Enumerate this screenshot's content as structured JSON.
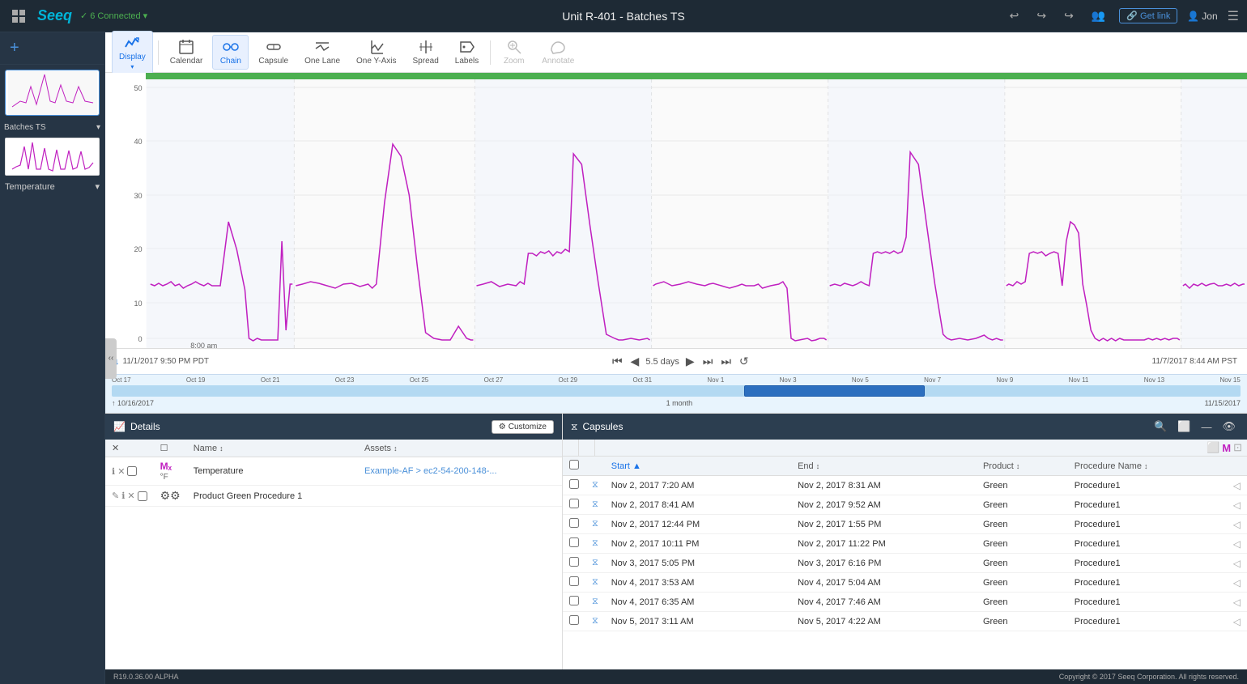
{
  "app": {
    "title": "Unit R-401 - Batches TS",
    "version": "R19.0.36.00 ALPHA",
    "copyright": "Copyright © 2017 Seeq Corporation. All rights reserved.",
    "logo": "Seeq",
    "connection": "6 Connected",
    "user": "Jon"
  },
  "toolbar": {
    "buttons": [
      {
        "id": "display",
        "label": "Display",
        "active": true
      },
      {
        "id": "calendar",
        "label": "Calendar",
        "active": false
      },
      {
        "id": "chain",
        "label": "Chain",
        "active": true
      },
      {
        "id": "capsule",
        "label": "Capsule",
        "active": false
      },
      {
        "id": "one-lane",
        "label": "One Lane",
        "active": false
      },
      {
        "id": "one-y-axis",
        "label": "One Y-Axis",
        "active": false
      },
      {
        "id": "spread",
        "label": "Spread",
        "active": false
      },
      {
        "id": "labels",
        "label": "Labels",
        "active": false
      },
      {
        "id": "zoom",
        "label": "Zoom",
        "active": false
      },
      {
        "id": "annotate",
        "label": "Annotate",
        "active": false
      }
    ]
  },
  "chart": {
    "y_axis_labels": [
      "50",
      "40",
      "30",
      "20",
      "10",
      "0"
    ],
    "x_axis_label": "8:00 am",
    "time_start": "11/1/2017 9:50 PM PDT",
    "time_end": "11/7/2017 8:44 AM PST",
    "period": "5.5 days"
  },
  "mini_timeline": {
    "labels": [
      "Oct 17",
      "Oct 19",
      "Oct 21",
      "Oct 23",
      "Oct 25",
      "Oct 27",
      "Oct 29",
      "Oct 31",
      "Nov 1",
      "Nov 3",
      "Nov 5",
      "Nov 7",
      "Nov 9",
      "Nov 11",
      "Nov 13",
      "Nov 15"
    ],
    "range_start": "10/16/2017",
    "range_end": "11/15/2017",
    "period": "1 month"
  },
  "details_panel": {
    "title": "Details",
    "customize_label": "Customize",
    "columns": [
      "",
      "",
      "Name ↕",
      "Assets ↕"
    ],
    "rows": [
      {
        "icons": [
          "ℹ",
          "✕",
          "☐",
          "Mₓ",
          "°F"
        ],
        "name": "Temperature",
        "assets": "Example-AF > ec2-54-200-148-...",
        "color": "#c020c0"
      },
      {
        "icons": [
          "✎",
          "ℹ",
          "✕",
          "☐",
          "⚙⚙"
        ],
        "name": "Product Green Procedure 1",
        "assets": "",
        "color": null
      }
    ]
  },
  "capsules_panel": {
    "title": "Capsules",
    "columns": [
      {
        "label": "Start ▲",
        "sort": "asc",
        "active": true
      },
      {
        "label": "End ↕",
        "sort": "none",
        "active": false
      },
      {
        "label": "Product ↕",
        "sort": "none",
        "active": false
      },
      {
        "label": "Procedure Name ↕",
        "sort": "none",
        "active": false
      }
    ],
    "rows": [
      {
        "start": "Nov 2, 2017 7:20 AM",
        "end": "Nov 2, 2017 8:31 AM",
        "product": "Green",
        "procedure": "Procedure1"
      },
      {
        "start": "Nov 2, 2017 8:41 AM",
        "end": "Nov 2, 2017 9:52 AM",
        "product": "Green",
        "procedure": "Procedure1"
      },
      {
        "start": "Nov 2, 2017 12:44 PM",
        "end": "Nov 2, 2017 1:55 PM",
        "product": "Green",
        "procedure": "Procedure1"
      },
      {
        "start": "Nov 2, 2017 10:11 PM",
        "end": "Nov 2, 2017 11:22 PM",
        "product": "Green",
        "procedure": "Procedure1"
      },
      {
        "start": "Nov 3, 2017 5:05 PM",
        "end": "Nov 3, 2017 6:16 PM",
        "product": "Green",
        "procedure": "Procedure1"
      },
      {
        "start": "Nov 4, 2017 3:53 AM",
        "end": "Nov 4, 2017 5:04 AM",
        "product": "Green",
        "procedure": "Procedure1"
      },
      {
        "start": "Nov 4, 2017 6:35 AM",
        "end": "Nov 4, 2017 7:46 AM",
        "product": "Green",
        "procedure": "Procedure1"
      },
      {
        "start": "Nov 5, 2017 3:11 AM",
        "end": "Nov 5, 2017 4:22 AM",
        "product": "Green",
        "procedure": "Procedure1"
      }
    ]
  },
  "sidebar": {
    "workbook_label": "Batches TS",
    "signal_label": "Temperature"
  }
}
